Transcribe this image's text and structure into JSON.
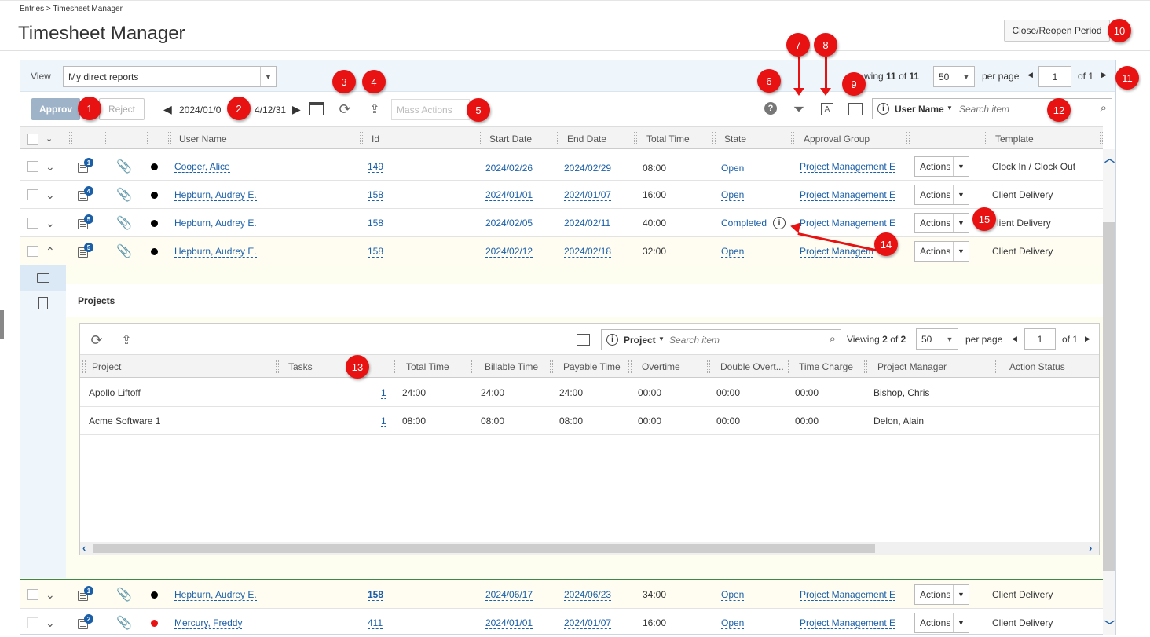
{
  "breadcrumb": "Entries > Timesheet Manager",
  "page_title": "Timesheet Manager",
  "close_reopen_label": "Close/Reopen Period",
  "view": {
    "label": "View",
    "value": "My direct reports"
  },
  "paging": {
    "viewing_prefix": "wing",
    "count": "11",
    "of_word": "of",
    "total": "11",
    "per_page_value": "50",
    "per_page_label": "per page",
    "page": "1",
    "of_pages": "of 1"
  },
  "toolbar": {
    "approve": "Approv",
    "reject": "Reject",
    "date_from": "2024/01/0",
    "date_to": "4/12/31",
    "mass_actions": "Mass Actions"
  },
  "search": {
    "field": "User Name",
    "placeholder": "Search item"
  },
  "columns": [
    "User Name",
    "Id",
    "Start Date",
    "End Date",
    "Total Time",
    "State",
    "Approval Group",
    "",
    "Template"
  ],
  "rows": [
    {
      "badge": "1",
      "user": "Cooper, Alice",
      "id": "149",
      "start": "2024/02/26",
      "end": "2024/02/29",
      "total": "08:00",
      "state": "Open",
      "group": "Project Management E",
      "action": "Actions",
      "template": "Clock In / Clock Out",
      "dot": "#000000"
    },
    {
      "badge": "4",
      "user": "Hepburn, Audrey E.",
      "id": "158",
      "start": "2024/01/01",
      "end": "2024/01/07",
      "total": "16:00",
      "state": "Open",
      "group": "Project Management E",
      "action": "Actions",
      "template": "Client Delivery",
      "dot": "#000000"
    },
    {
      "badge": "5",
      "user": "Hepburn, Audrey E.",
      "id": "158",
      "start": "2024/02/05",
      "end": "2024/02/11",
      "total": "40:00",
      "state": "Completed",
      "group": "Project Management E",
      "action": "Actions",
      "template": "lient Delivery",
      "dot": "#000000"
    },
    {
      "badge": "5",
      "user": "Hepburn, Audrey E.",
      "id": "158",
      "start": "2024/02/12",
      "end": "2024/02/18",
      "total": "32:00",
      "state": "Open",
      "group": "Project Managem",
      "action": "Actions",
      "template": "Client Delivery",
      "dot": "#000000"
    },
    {
      "badge": "1",
      "user": "Hepburn, Audrey E.",
      "id": "158",
      "start": "2024/06/17",
      "end": "2024/06/23",
      "total": "34:00",
      "state": "Open",
      "group": "Project Management E",
      "action": "Actions",
      "template": "Client Delivery",
      "dot": "#000000"
    },
    {
      "badge": "2",
      "user": "Mercury, Freddy",
      "id": "411",
      "start": "2024/01/01",
      "end": "2024/01/07",
      "total": "16:00",
      "state": "Open",
      "group": "Project Management E",
      "action": "Actions",
      "template": "Client Delivery",
      "dot": "#e81212"
    }
  ],
  "projects": {
    "title": "Projects",
    "search_field": "Project",
    "search_placeholder": "Search item",
    "viewing_label": "Viewing",
    "count": "2",
    "of_word": "of",
    "total": "2",
    "per_page_value": "50",
    "per_page_label": "per page",
    "page": "1",
    "of_pages": "of 1",
    "columns": [
      "Project",
      "Tasks",
      "Total Time",
      "Billable Time",
      "Payable Time",
      "Overtime",
      "Double Overt...",
      "Time Charge",
      "Project Manager",
      "Action Status"
    ],
    "rows": [
      {
        "project": "Apollo Liftoff",
        "tasks": "1",
        "total": "24:00",
        "billable": "24:00",
        "payable": "24:00",
        "overtime": "00:00",
        "double": "00:00",
        "charge": "00:00",
        "manager": "Bishop, Chris"
      },
      {
        "project": "Acme Software 1",
        "tasks": "1",
        "total": "08:00",
        "billable": "08:00",
        "payable": "08:00",
        "overtime": "00:00",
        "double": "00:00",
        "charge": "00:00",
        "manager": "Delon, Alain"
      }
    ]
  },
  "callouts": [
    "1",
    "2",
    "3",
    "4",
    "5",
    "6",
    "7",
    "8",
    "9",
    "10",
    "11",
    "12",
    "13",
    "14",
    "15"
  ],
  "colors": {
    "link": "#1a5fa8",
    "callout": "#e81212",
    "header_bg": "#f3f3f3",
    "viewbar_bg": "#eef5fb"
  }
}
